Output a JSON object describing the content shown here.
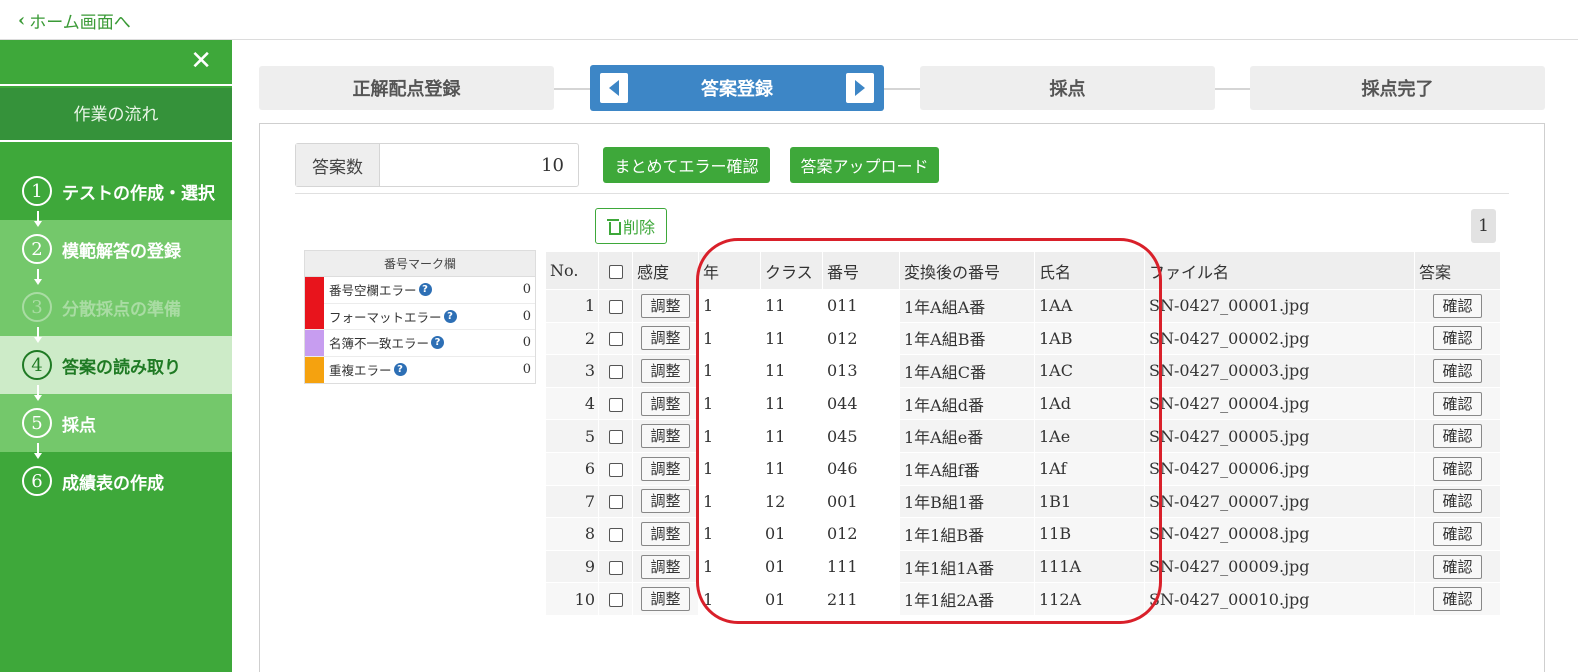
{
  "topbar": {
    "back_label": "ホーム画面へ"
  },
  "sidebar": {
    "close_label": "✕",
    "flow_title": "作業の流れ",
    "steps": [
      {
        "num": "1",
        "label": "テストの作成・選択"
      },
      {
        "num": "2",
        "label": "模範解答の登録"
      },
      {
        "num": "3",
        "label": "分散採点の準備"
      },
      {
        "num": "4",
        "label": "答案の読み取り"
      },
      {
        "num": "5",
        "label": "採点"
      },
      {
        "num": "6",
        "label": "成績表の作成"
      }
    ]
  },
  "tabs": [
    {
      "label": "正解配点登録"
    },
    {
      "label": "答案登録"
    },
    {
      "label": "採点"
    },
    {
      "label": "採点完了"
    }
  ],
  "toolbar": {
    "count_label": "答案数",
    "count_value": "10",
    "error_check_label": "まとめてエラー確認",
    "upload_label": "答案アップロード",
    "delete_label": "削除",
    "page_number": "1"
  },
  "legend": {
    "title": "番号マーク欄",
    "items": [
      {
        "label": "番号空欄エラー",
        "count": "0",
        "color": "#e8141c"
      },
      {
        "label": "フォーマットエラー",
        "count": "0",
        "color": "#e8141c"
      },
      {
        "label": "名簿不一致エラー",
        "count": "0",
        "color": "#c79df0"
      },
      {
        "label": "重複エラー",
        "count": "0",
        "color": "#f5a20f"
      }
    ]
  },
  "table": {
    "headers": [
      "No.",
      "",
      "感度",
      "年",
      "クラス",
      "番号",
      "変換後の番号",
      "氏名",
      "ファイル名",
      "答案"
    ],
    "adjust_label": "調整",
    "confirm_label": "確認",
    "rows": [
      {
        "no": "1",
        "year": "1",
        "class": "11",
        "number": "011",
        "converted": "1年A組A番",
        "name": "1AA",
        "file": "SN-0427_00001.jpg"
      },
      {
        "no": "2",
        "year": "1",
        "class": "11",
        "number": "012",
        "converted": "1年A組B番",
        "name": "1AB",
        "file": "SN-0427_00002.jpg"
      },
      {
        "no": "3",
        "year": "1",
        "class": "11",
        "number": "013",
        "converted": "1年A組C番",
        "name": "1AC",
        "file": "SN-0427_00003.jpg"
      },
      {
        "no": "4",
        "year": "1",
        "class": "11",
        "number": "044",
        "converted": "1年A組d番",
        "name": "1Ad",
        "file": "SN-0427_00004.jpg"
      },
      {
        "no": "5",
        "year": "1",
        "class": "11",
        "number": "045",
        "converted": "1年A組e番",
        "name": "1Ae",
        "file": "SN-0427_00005.jpg"
      },
      {
        "no": "6",
        "year": "1",
        "class": "11",
        "number": "046",
        "converted": "1年A組f番",
        "name": "1Af",
        "file": "SN-0427_00006.jpg"
      },
      {
        "no": "7",
        "year": "1",
        "class": "12",
        "number": "001",
        "converted": "1年B組1番",
        "name": "1B1",
        "file": "SN-0427_00007.jpg"
      },
      {
        "no": "8",
        "year": "1",
        "class": "01",
        "number": "012",
        "converted": "1年1組B番",
        "name": "11B",
        "file": "SN-0427_00008.jpg"
      },
      {
        "no": "9",
        "year": "1",
        "class": "01",
        "number": "111",
        "converted": "1年1組1A番",
        "name": "111A",
        "file": "SN-0427_00009.jpg"
      },
      {
        "no": "10",
        "year": "1",
        "class": "01",
        "number": "211",
        "converted": "1年1組2A番",
        "name": "112A",
        "file": "SN-0427_00010.jpg"
      }
    ]
  },
  "colors": {
    "brand_green": "#3ea83a",
    "active_tab": "#3d86c6",
    "highlight": "#d9202a"
  }
}
